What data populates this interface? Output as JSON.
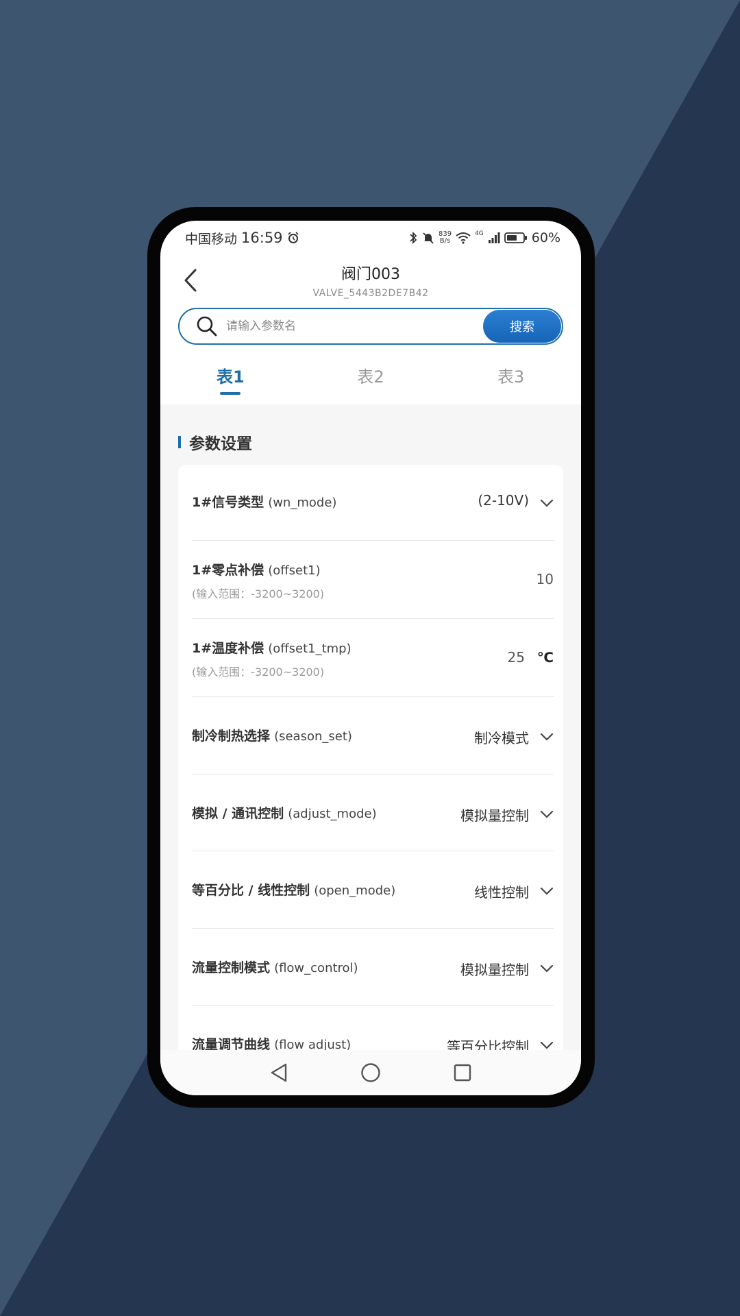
{
  "theme": {
    "accent": "#1f6fa8",
    "bg_light": "#3e5570",
    "bg_dark": "#243650"
  },
  "status_bar": {
    "carrier": "中国移动",
    "time": "16:59",
    "net_speed_top": "839",
    "net_speed_bottom": "B/s",
    "net_type": "4G",
    "battery": "60%"
  },
  "header": {
    "title": "阀门003",
    "subtitle": "VALVE_5443B2DE7B42"
  },
  "search": {
    "placeholder": "请输入参数名",
    "button_label": "搜索"
  },
  "tabs": [
    {
      "label": "表1",
      "active": true
    },
    {
      "label": "表2",
      "active": false
    },
    {
      "label": "表3",
      "active": false
    }
  ],
  "section": {
    "title": "参数设置"
  },
  "params": [
    {
      "name": "1#信号类型",
      "code": "(wn_mode)",
      "value": "(2-10V)",
      "control": "dropdown"
    },
    {
      "name": "1#零点补偿",
      "code": "(offset1)",
      "hint": "(输入范围：-3200~3200)",
      "value": "10",
      "control": "input"
    },
    {
      "name": "1#温度补偿",
      "code": "(offset1_tmp)",
      "hint": "(输入范围：-3200~3200)",
      "value": "25",
      "unit": "℃",
      "control": "input"
    },
    {
      "name": "制冷制热选择",
      "code": "(season_set)",
      "value": "制冷模式",
      "control": "dropdown"
    },
    {
      "name": "模拟 / 通讯控制",
      "code": "(adjust_mode)",
      "value": "模拟量控制",
      "control": "dropdown"
    },
    {
      "name": "等百分比 / 线性控制",
      "code": "(open_mode)",
      "value": "线性控制",
      "control": "dropdown"
    },
    {
      "name": "流量控制模式",
      "code": "(flow_control)",
      "value": "模拟量控制",
      "control": "dropdown"
    },
    {
      "name": "流量调节曲线",
      "code": "(flow adjust)",
      "value": "等百分比控制",
      "control": "dropdown"
    }
  ],
  "icons": {
    "back": "chevron-left-icon",
    "search": "search-icon",
    "dropdown": "chevron-down-icon",
    "nav_back": "triangle-back-icon",
    "nav_home": "circle-home-icon",
    "nav_recent": "square-recent-icon"
  }
}
